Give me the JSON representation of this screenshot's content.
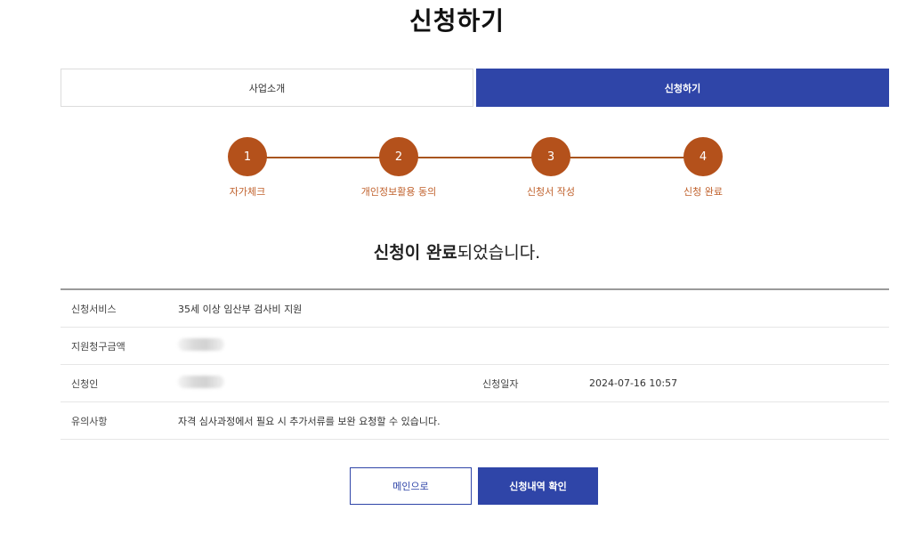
{
  "page": {
    "title": "신청하기"
  },
  "tabs": [
    {
      "label": "사업소개",
      "active": false
    },
    {
      "label": "신청하기",
      "active": true
    }
  ],
  "steps": [
    {
      "number": "1",
      "label": "자가체크"
    },
    {
      "number": "2",
      "label": "개인정보활용 동의"
    },
    {
      "number": "3",
      "label": "신청서 작성"
    },
    {
      "number": "4",
      "label": "신청 완료"
    }
  ],
  "complete": {
    "bold": "신청이 완료",
    "rest": "되었습니다."
  },
  "info": {
    "service_label": "신청서비스",
    "service_value": "35세 이상 임산부 검사비 지원",
    "amount_label": "지원청구금액",
    "applicant_label": "신청인",
    "date_label": "신청일자",
    "date_value": "2024-07-16 10:57",
    "notice_label": "유의사항",
    "notice_value": "자격 심사과정에서 필요 시 추가서류를 보완 요청할 수 있습니다."
  },
  "buttons": {
    "main": "메인으로",
    "history": "신청내역 확인"
  },
  "colors": {
    "primary": "#2f45a8",
    "step": "#b4511b",
    "step_label": "#c0612c"
  }
}
